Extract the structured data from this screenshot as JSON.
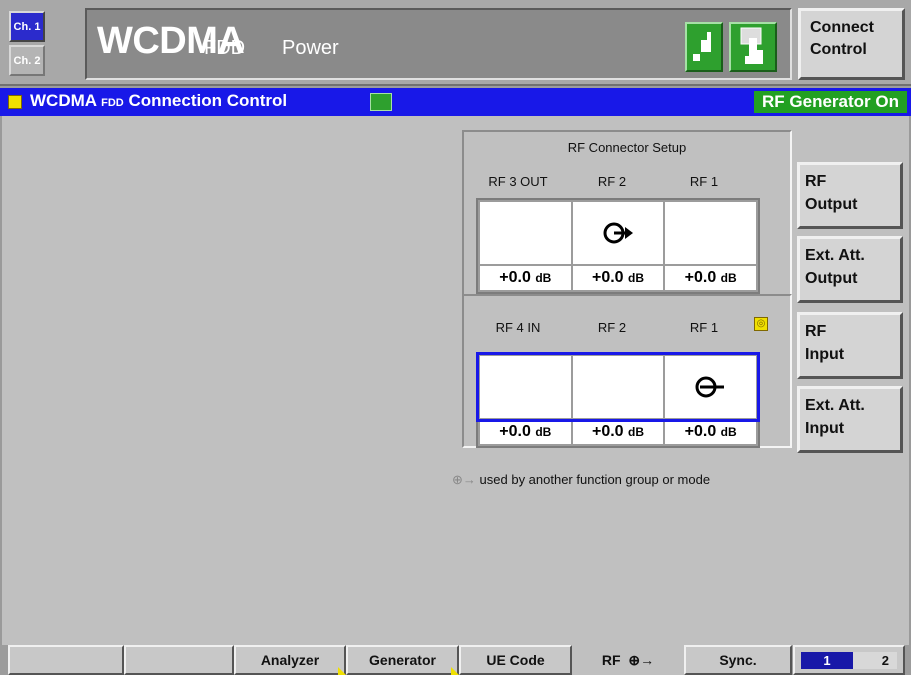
{
  "channels": {
    "ch1": "Ch. 1",
    "ch2": "Ch. 2"
  },
  "title": {
    "main": "WCDMA",
    "sub": "FDD",
    "mode": "Power"
  },
  "connect_control": {
    "line1": "Connect",
    "line2": "Control"
  },
  "subheader": {
    "title": "WCDMA",
    "fdd": "FDD",
    "rest": "Connection Control",
    "status": "RF Generator On"
  },
  "output_setup": {
    "title": "RF Connector Setup",
    "columns": [
      "RF 3 OUT",
      "RF 2",
      "RF 1"
    ],
    "values": [
      "+0.0",
      "+0.0",
      "+0.0"
    ],
    "unit": "dB",
    "active_symbol": "⟴",
    "active_index": 1
  },
  "input_setup": {
    "columns": [
      "RF 4 IN",
      "RF 2",
      "RF 1"
    ],
    "values": [
      "+0.0",
      "+0.0",
      "+0.0"
    ],
    "unit": "dB",
    "active_symbol": "⟵",
    "active_index": 2
  },
  "note": "used by another function group or mode",
  "side_buttons": [
    {
      "line1": "RF",
      "line2": "Output"
    },
    {
      "line1": "Ext. Att.",
      "line2": "Output"
    },
    {
      "line1": "RF",
      "line2": "Input"
    },
    {
      "line1": "Ext. Att.",
      "line2": "Input"
    }
  ],
  "softkeys": [
    "",
    "",
    "Analyzer",
    "Generator",
    "UE Code",
    "RF",
    "Sync."
  ],
  "pager": {
    "p1": "1",
    "p2": "2"
  },
  "colors": {
    "accent_blue": "#1818e8",
    "green": "#22a022",
    "yellow": "#f0e000"
  }
}
